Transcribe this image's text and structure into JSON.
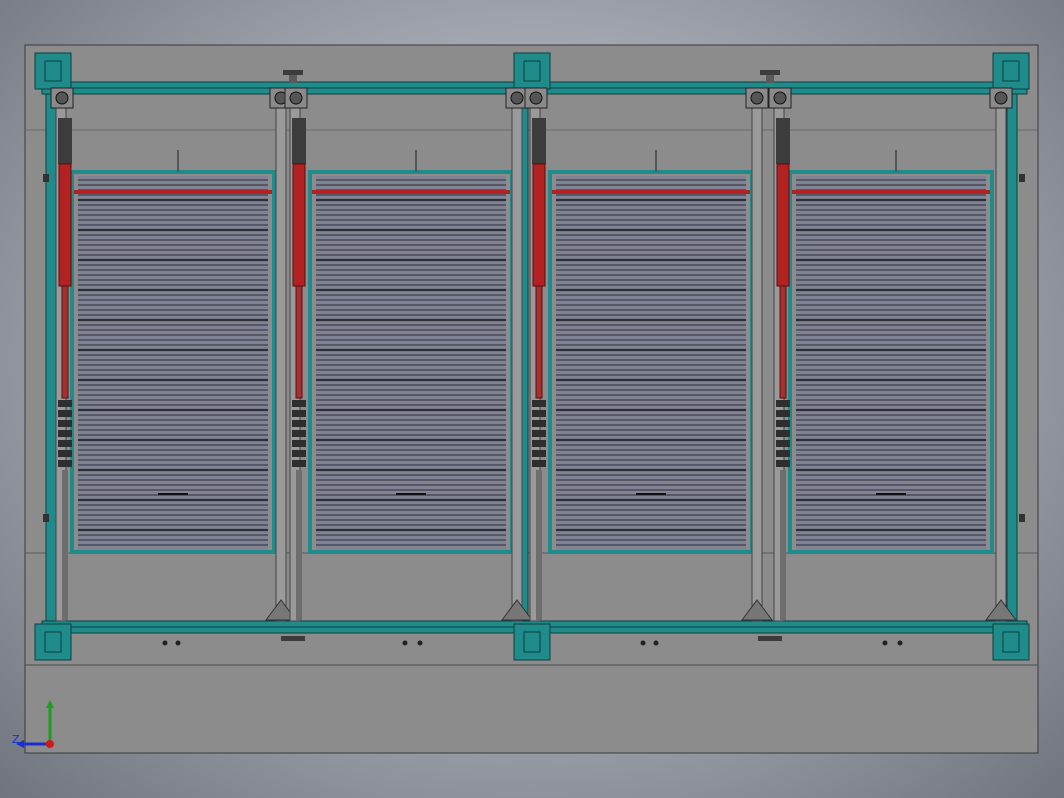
{
  "window": {
    "title": ""
  },
  "colors": {
    "background_center": "#c9ccd3",
    "background_edge": "#6f747d",
    "sheet": "#8c8c8c",
    "frame_teal": "#1f8b8b",
    "frame_dark": "#0d4f4f",
    "cylinder_red": "#b22222",
    "slat_dark": "#2d2f36",
    "slat_light": "#7f8394",
    "post_gray": "#9a9a9a"
  },
  "icons": {
    "triad": "coordinate-triad-icon",
    "bearing": "pillow-block-bearing-icon",
    "cylinder": "hydraulic-cylinder-icon"
  },
  "model": {
    "bays": 4,
    "cylinders_per_bay": 1
  },
  "triad": {
    "z_label": "Z"
  }
}
